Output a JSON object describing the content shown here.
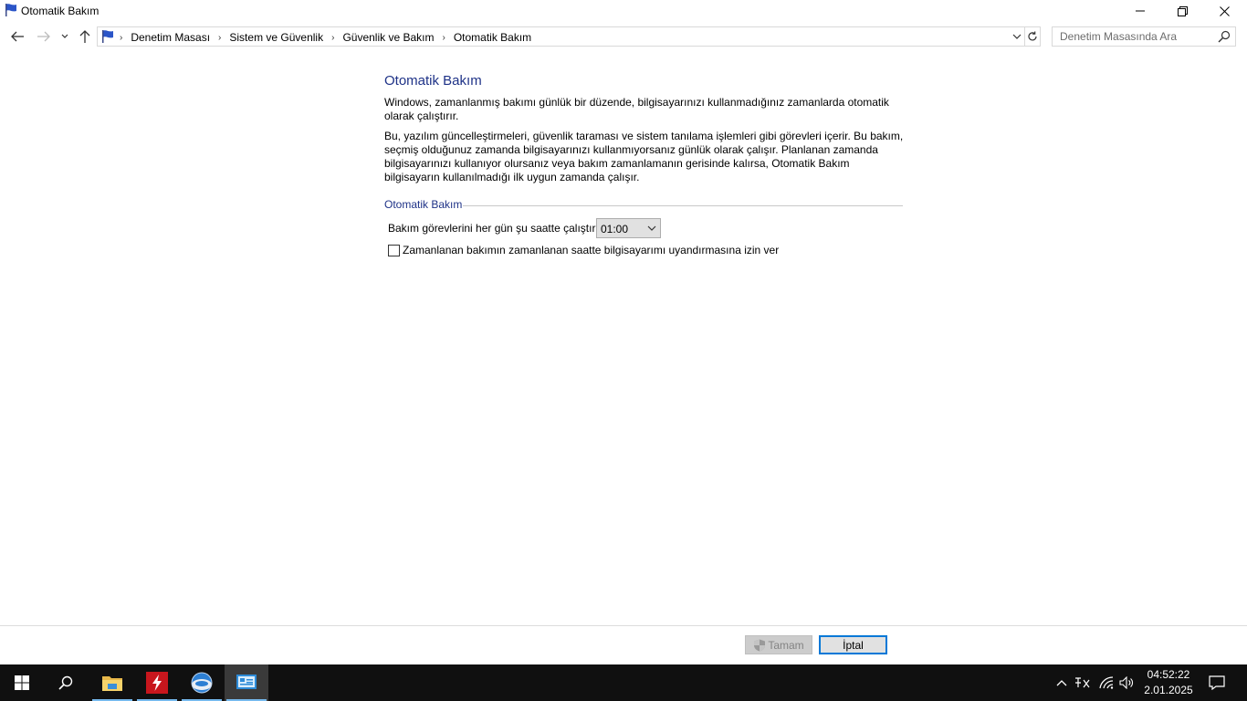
{
  "window": {
    "title": "Otomatik Bakım"
  },
  "nav": {
    "breadcrumbs": [
      "Denetim Masası",
      "Sistem ve Güvenlik",
      "Güvenlik ve Bakım",
      "Otomatik Bakım"
    ],
    "search_placeholder": "Denetim Masasında Ara"
  },
  "main": {
    "heading": "Otomatik Bakım",
    "paragraph1": "Windows, zamanlanmış bakımı günlük bir düzende, bilgisayarınızı kullanmadığınız zamanlarda otomatik olarak çalıştırır.",
    "paragraph2": "Bu, yazılım güncelleştirmeleri, güvenlik taraması ve sistem tanılama işlemleri gibi görevleri içerir. Bu bakım, seçmiş olduğunuz zamanda bilgisayarınızı kullanmıyorsanız günlük olarak çalışır. Planlanan zamanda bilgisayarınızı kullanıyor olursanız veya bakım zamanlamanın gerisinde kalırsa, Otomatik Bakım bilgisayarın kullanılmadığı ilk uygun zamanda çalışır.",
    "group_title": "Otomatik Bakım",
    "time_label": "Bakım görevlerini her gün şu saatte çalıştır",
    "time_value": "01:00",
    "wake_label": "Zamanlanan bakımın zamanlanan saatte bilgisayarımı uyandırmasına izin ver",
    "wake_checked": false
  },
  "footer": {
    "ok_label": "Tamam",
    "cancel_label": "İptal"
  },
  "taskbar": {
    "time": "04:52:22",
    "date": "2.01.2025",
    "apps": [
      "file-explorer",
      "flash",
      "browser",
      "control-panel"
    ]
  },
  "colors": {
    "heading": "#1e3287",
    "taskbar": "#101010",
    "accent": "#0078d7"
  }
}
